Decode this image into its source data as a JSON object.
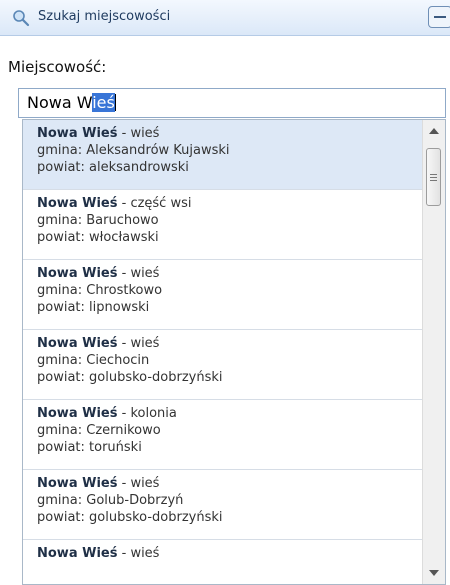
{
  "header": {
    "title": "Szukaj miejscowości",
    "icon": "search-icon"
  },
  "form": {
    "label": "Miejscowość:",
    "input_prefix": "Nowa W",
    "input_selected": "ieś"
  },
  "results": [
    {
      "name": "Nowa Wieś",
      "kind": " - wieś",
      "gmina": "gmina: Aleksandrów Kujawski",
      "powiat": "powiat: aleksandrowski"
    },
    {
      "name": "Nowa Wieś",
      "kind": " - część wsi",
      "gmina": "gmina: Baruchowo",
      "powiat": "powiat: włocławski"
    },
    {
      "name": "Nowa Wieś",
      "kind": " - wieś",
      "gmina": "gmina: Chrostkowo",
      "powiat": "powiat: lipnowski"
    },
    {
      "name": "Nowa Wieś",
      "kind": " - wieś",
      "gmina": "gmina: Ciechocin",
      "powiat": "powiat: golubsko-dobrzyński"
    },
    {
      "name": "Nowa Wieś",
      "kind": " - kolonia",
      "gmina": "gmina: Czernikowo",
      "powiat": "powiat: toruński"
    },
    {
      "name": "Nowa Wieś",
      "kind": " - wieś",
      "gmina": "gmina: Golub-Dobrzyń",
      "powiat": "powiat: golubsko-dobrzyński"
    },
    {
      "name": "Nowa Wieś",
      "kind": " - wieś"
    }
  ]
}
